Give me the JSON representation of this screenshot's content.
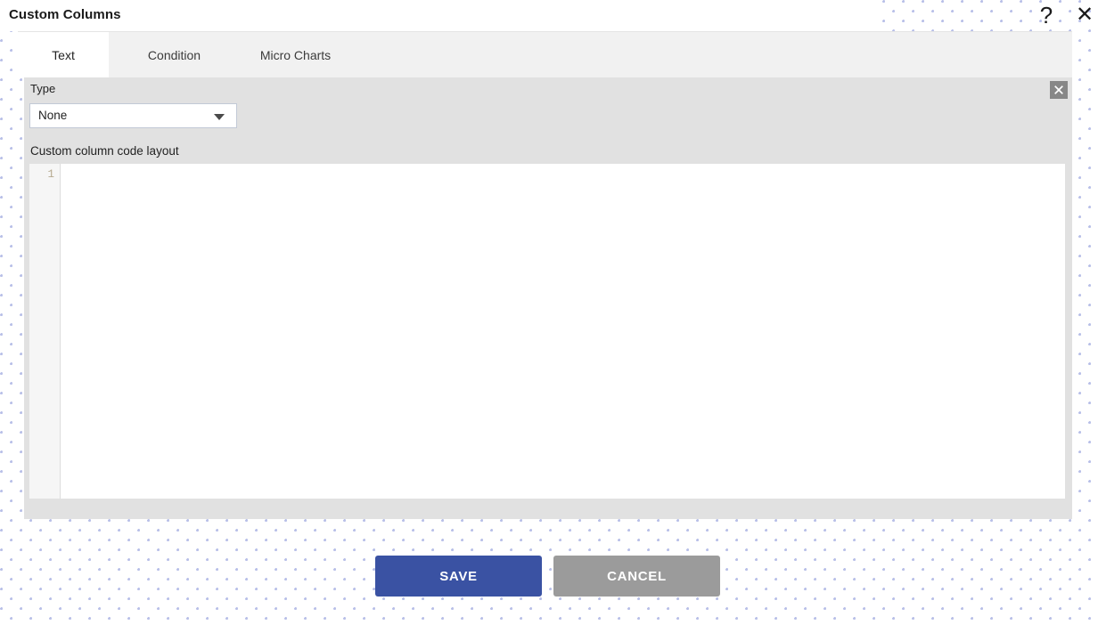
{
  "window": {
    "title": "Custom Columns",
    "help_icon": "question-mark-icon",
    "close_icon": "close-icon",
    "help_glyph": "?",
    "close_glyph": "✕"
  },
  "tabs": [
    {
      "label": "Text",
      "active": true
    },
    {
      "label": "Condition",
      "active": false
    },
    {
      "label": "Micro Charts",
      "active": false
    }
  ],
  "form": {
    "type_label": "Type",
    "type_select": {
      "value": "None",
      "options": [
        "None"
      ],
      "arrow_icon": "chevron-down-icon"
    },
    "code_label": "Custom column code layout",
    "editor": {
      "line_numbers": [
        "1"
      ],
      "content": "",
      "placeholder": ""
    },
    "close_button_icon": "close-icon"
  },
  "footer": {
    "save_label": "SAVE",
    "cancel_label": "CANCEL"
  },
  "colors": {
    "accent_blue": "#3a52a3",
    "cancel_gray": "#9b9b9b",
    "panel_gray": "#e1e1e1",
    "tabstrip_gray": "#f1f1f1",
    "gutter_gray": "#f6f6f6",
    "dot_pattern": "#b9c0e8",
    "line_number": "#b5a98f"
  }
}
